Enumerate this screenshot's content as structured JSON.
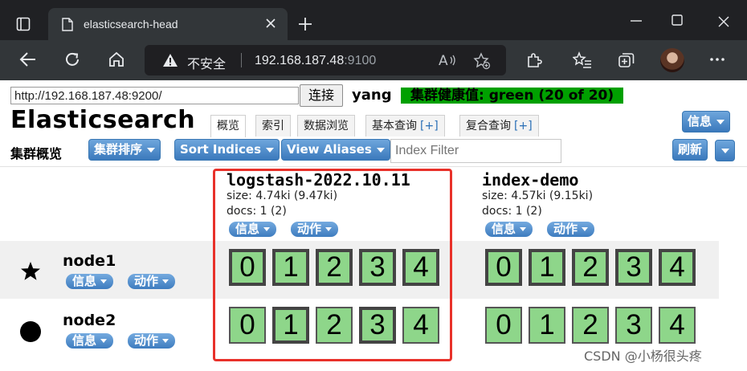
{
  "browser": {
    "tab_title": "elasticsearch-head",
    "security_label": "不安全",
    "url_host": "192.168.187.48",
    "url_port": ":9100"
  },
  "toolbar": {
    "cluster_url": "http://192.168.187.48:9200/",
    "connect_label": "连接",
    "cluster_name": "yang",
    "health": "集群健康值: green (20 of 20)",
    "app_title": "Elasticsearch",
    "info_menu_label": "信息"
  },
  "nav_tabs": [
    {
      "label": "概览"
    },
    {
      "label": "索引"
    },
    {
      "label": "数据浏览"
    },
    {
      "label": "基本查询",
      "plus": "[+]"
    },
    {
      "label": "复合查询",
      "plus": "[+]"
    }
  ],
  "overview": {
    "title": "集群概览",
    "sort_cluster_label": "集群排序",
    "sort_indices_label": "Sort Indices",
    "view_aliases_label": "View Aliases",
    "index_filter_placeholder": "Index Filter",
    "refresh_label": "刷新"
  },
  "indices": [
    {
      "name": "logstash-2022.10.11",
      "size": "size: 4.74ki (9.47ki)",
      "docs": "docs: 1 (2)",
      "info_label": "信息",
      "action_label": "动作"
    },
    {
      "name": "index-demo",
      "size": "size: 4.57ki (9.15ki)",
      "docs": "docs: 1 (2)",
      "info_label": "信息",
      "action_label": "动作"
    }
  ],
  "nodes": [
    {
      "name": "node1",
      "info_label": "信息",
      "action_label": "动作",
      "role_icon": "star-icon"
    },
    {
      "name": "node2",
      "info_label": "信息",
      "action_label": "动作",
      "role_icon": "circle-icon"
    }
  ],
  "shards": {
    "labels": [
      "0",
      "1",
      "2",
      "3",
      "4"
    ],
    "node1_logstash": [
      "0",
      "1",
      "2",
      "3",
      "4"
    ],
    "node2_logstash": [
      "0",
      "1",
      "2",
      "3",
      "4"
    ],
    "node1_demo": [
      "0",
      "1",
      "2",
      "3",
      "4"
    ],
    "node2_demo": [
      "0",
      "1",
      "2",
      "3",
      "4"
    ]
  },
  "colors": {
    "health_green": "#00a000",
    "shard_fill": "#8ed68a",
    "highlight_red": "#e8312a",
    "button_blue": "#3b79bc"
  },
  "watermark": "CSDN @小杨很头疼"
}
